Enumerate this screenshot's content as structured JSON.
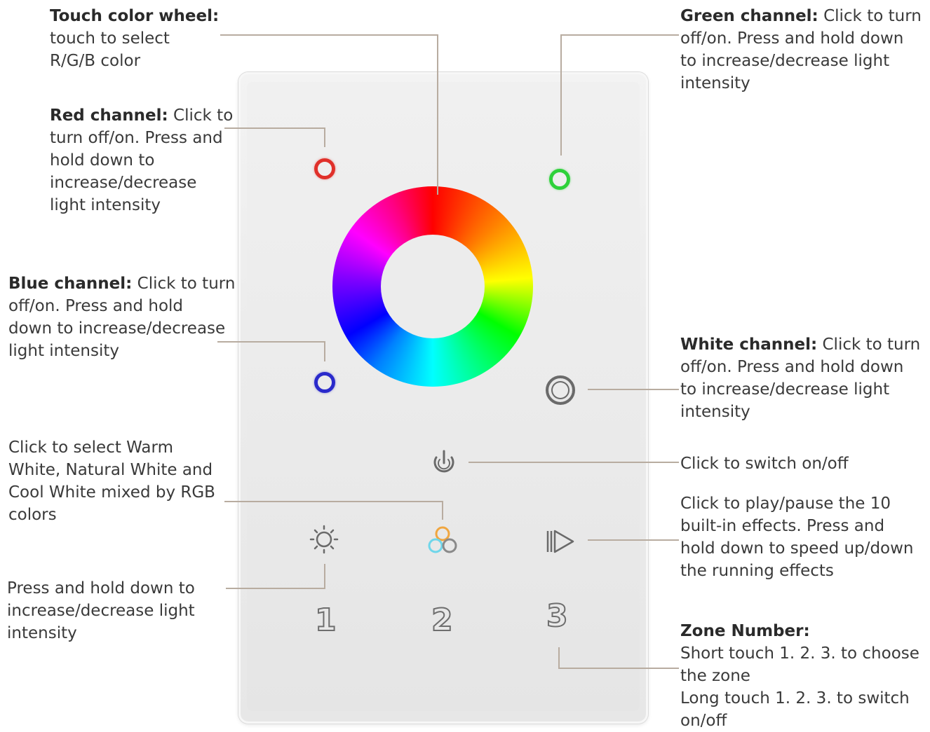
{
  "annotations": {
    "touch_wheel": {
      "title": "Touch color wheel:",
      "lines": [
        "touch to select",
        "R/G/B color"
      ]
    },
    "red_channel": {
      "title": "Red channel:",
      "lines": [
        " Click to",
        "turn off/on. Press and",
        "hold down to",
        "increase/decrease",
        "light intensity"
      ]
    },
    "blue_channel": {
      "title": "Blue channel:",
      "lines": [
        " Click to turn",
        "off/on. Press and hold",
        "down to increase/decrease",
        "light intensity"
      ]
    },
    "warm_white": {
      "lines": [
        "Click to select Warm",
        "White, Natural White and",
        "Cool White mixed by RGB",
        "colors"
      ]
    },
    "brightness": {
      "lines": [
        "Press and hold down to",
        "increase/decrease light",
        "intensity"
      ]
    },
    "green_channel": {
      "title": "Green channel:",
      "lines": [
        " Click to turn",
        "off/on. Press and hold down",
        "to increase/decrease light",
        "intensity"
      ]
    },
    "white_channel": {
      "title": "White channel:",
      "lines": [
        " Click to turn",
        "off/on. Press and hold down",
        "to increase/decrease light",
        "intensity"
      ]
    },
    "power": {
      "lines": [
        "Click to switch on/off"
      ]
    },
    "play": {
      "lines": [
        "Click to play/pause the 10",
        "built-in effects. Press and",
        "hold down to speed up/down",
        "the running effects"
      ]
    },
    "zone": {
      "title": "Zone Number:",
      "lines": [
        "Short touch 1. 2. 3. to choose",
        "the zone",
        "Long touch 1. 2. 3. to switch",
        "on/off"
      ]
    }
  },
  "device": {
    "zones": [
      "1",
      "2",
      "3"
    ],
    "buttons": {
      "red": "red-channel-button",
      "green": "green-channel-button",
      "blue": "blue-channel-button",
      "white": "white-channel-button",
      "power": "power-icon",
      "brightness": "sun-icon",
      "mix": "three-circles-icon",
      "play": "play-pause-icon"
    }
  },
  "colors": {
    "leader_line": "#b8aca0",
    "red": "#e0302a",
    "green": "#2ed13a",
    "blue": "#2a2acb",
    "white_ring": "#6a6a6a",
    "text": "#3a3a3a"
  }
}
